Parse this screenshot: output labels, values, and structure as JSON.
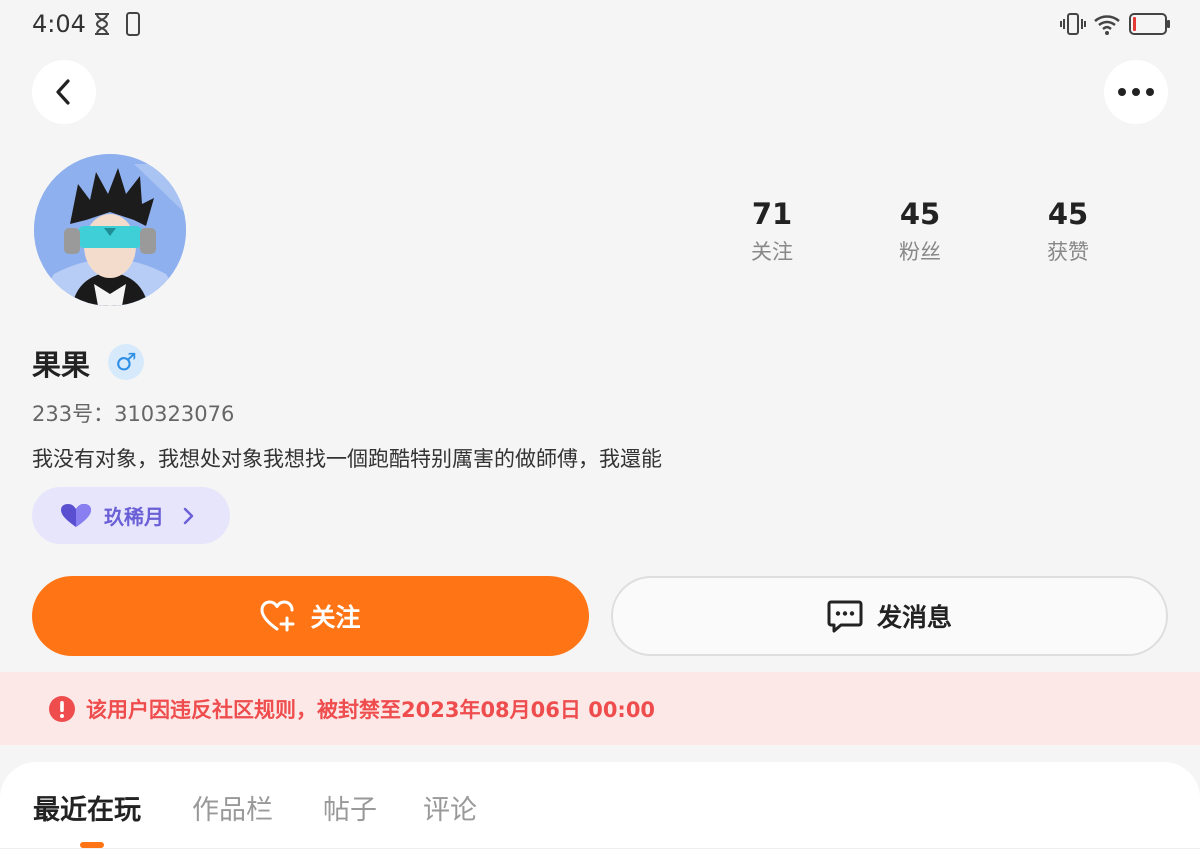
{
  "status": {
    "time": "4:04"
  },
  "profile": {
    "name": "果果",
    "gender_symbol": "♂",
    "user_id": "233号：310323076",
    "bio": "我没有对象，我想处对象我想找一個跑酷特别厲害的做師傅，我還能",
    "guild": "玖稀月"
  },
  "stats": [
    {
      "value": "71",
      "label": "关注"
    },
    {
      "value": "45",
      "label": "粉丝"
    },
    {
      "value": "45",
      "label": "获赞"
    }
  ],
  "actions": {
    "follow": "关注",
    "message": "发消息"
  },
  "ban_notice": "该用户因违反社区规则，被封禁至2023年08月06日 00:00",
  "tabs": [
    "最近在玩",
    "作品栏",
    "帖子",
    "评论"
  ],
  "colors": {
    "accent": "#ff7516",
    "ban_text": "#ef4d4d",
    "guild": "#6a5fd6",
    "gender": "#2f8fe5"
  }
}
